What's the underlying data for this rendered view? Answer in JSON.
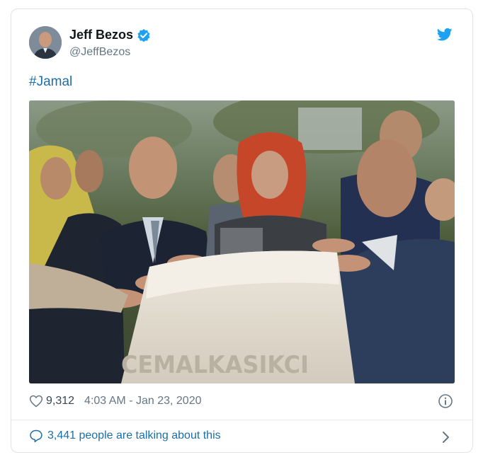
{
  "tweet": {
    "author_name": "Jeff Bezos",
    "author_handle": "@JeffBezos",
    "text": "#Jamal",
    "likes": "9,312",
    "timestamp": "4:03 AM - Jan 23, 2020",
    "talking": "3,441 people are talking about this",
    "photo_inscription": "CEMALKASIKCI"
  },
  "icons": {
    "verified": "verified-badge-icon",
    "bird": "twitter-bird-icon",
    "heart": "heart-icon",
    "info": "info-icon",
    "bubble": "speech-bubble-icon",
    "chevron": "chevron-right-icon"
  },
  "colors": {
    "accent": "#1da1f2",
    "link": "#1b6fa8",
    "secondary": "#657786",
    "border": "#dfe3e6"
  }
}
